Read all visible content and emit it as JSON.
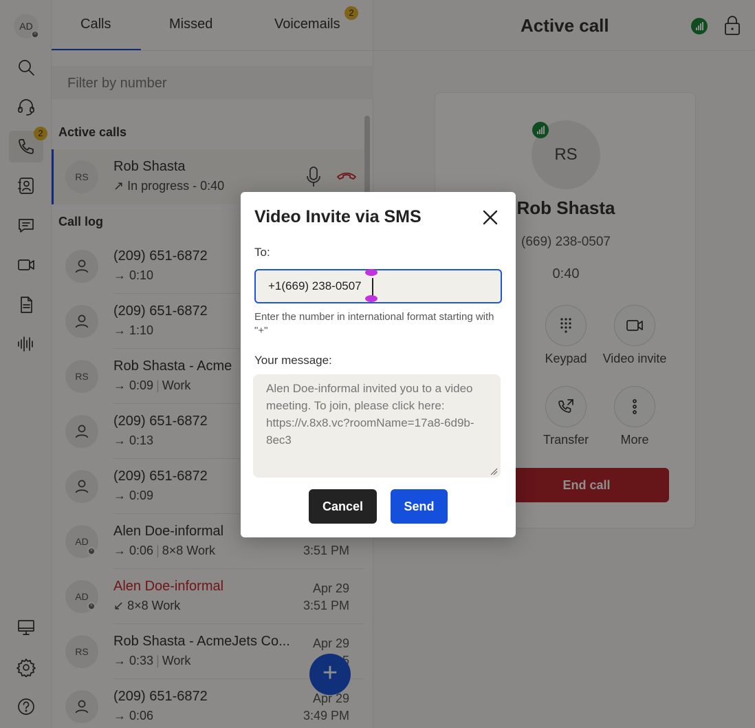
{
  "rail": {
    "avatar_initials": "AD",
    "calls_badge": "2"
  },
  "tabs": {
    "calls": "Calls",
    "missed": "Missed",
    "voicemails": "Voicemails",
    "voicemails_badge": "2"
  },
  "filter_placeholder": "Filter by number",
  "active_calls": {
    "title": "Active calls",
    "row": {
      "initials": "RS",
      "name": "Rob Shasta",
      "status": "In progress - 0:40"
    }
  },
  "call_log": {
    "title": "Call log",
    "rows": [
      {
        "initials": "",
        "name": "(209) 651-6872",
        "duration": "0:10",
        "line": "",
        "date": "",
        "time": "",
        "missed": false
      },
      {
        "initials": "",
        "name": "(209) 651-6872",
        "duration": "1:10",
        "line": "",
        "date": "",
        "time": "",
        "missed": false
      },
      {
        "initials": "RS",
        "name": "Rob Shasta - Acme",
        "duration": "0:09",
        "line": "Work",
        "date": "",
        "time": "",
        "missed": false
      },
      {
        "initials": "",
        "name": "(209) 651-6872",
        "duration": "0:13",
        "line": "",
        "date": "",
        "time": "",
        "missed": false
      },
      {
        "initials": "",
        "name": "(209) 651-6872",
        "duration": "0:09",
        "line": "",
        "date": "",
        "time": "",
        "missed": false
      },
      {
        "initials": "AD",
        "name": "Alen Doe-informal",
        "duration": "0:06",
        "line": "8×8 Work",
        "date": "",
        "time": "3:51 PM",
        "missed": false
      },
      {
        "initials": "AD",
        "name": "Alen Doe-informal",
        "duration": "",
        "line": "8×8 Work",
        "date": "Apr 29",
        "time": "3:51 PM",
        "missed": true
      },
      {
        "initials": "RS",
        "name": "Rob Shasta - AcmeJets Co...",
        "duration": "0:33",
        "line": "Work",
        "date": "Apr 29",
        "time": "3:5",
        "missed": false
      },
      {
        "initials": "",
        "name": "(209) 651-6872",
        "duration": "0:06",
        "line": "",
        "date": "Apr 29",
        "time": "3:49 PM",
        "missed": false
      }
    ]
  },
  "fab_label": "+",
  "active_call": {
    "header": "Active call",
    "initials": "RS",
    "name": "Rob Shasta",
    "number": "(669) 238-0507",
    "timer": "0:40",
    "controls": {
      "keypad": "Keypad",
      "video_invite": "Video invite",
      "transfer": "Transfer",
      "more": "More"
    },
    "end_call": "End call"
  },
  "modal": {
    "title": "Video Invite via SMS",
    "to_label": "To:",
    "to_value": "+1(669) 238-0507",
    "hint": "Enter the number in international format starting with \"+\"",
    "message_label": "Your message:",
    "message_text": "Alen Doe-informal invited you to a video meeting. To join, please click here: https://v.8x8.vc?roomName=17a8-6d9b-8ec3",
    "cancel": "Cancel",
    "send": "Send"
  },
  "colors": {
    "accent": "#1d56d8",
    "end_call": "#b6272d",
    "missed": "#c9262c",
    "badge": "#e3b22b",
    "signal": "#1c8a3a"
  }
}
